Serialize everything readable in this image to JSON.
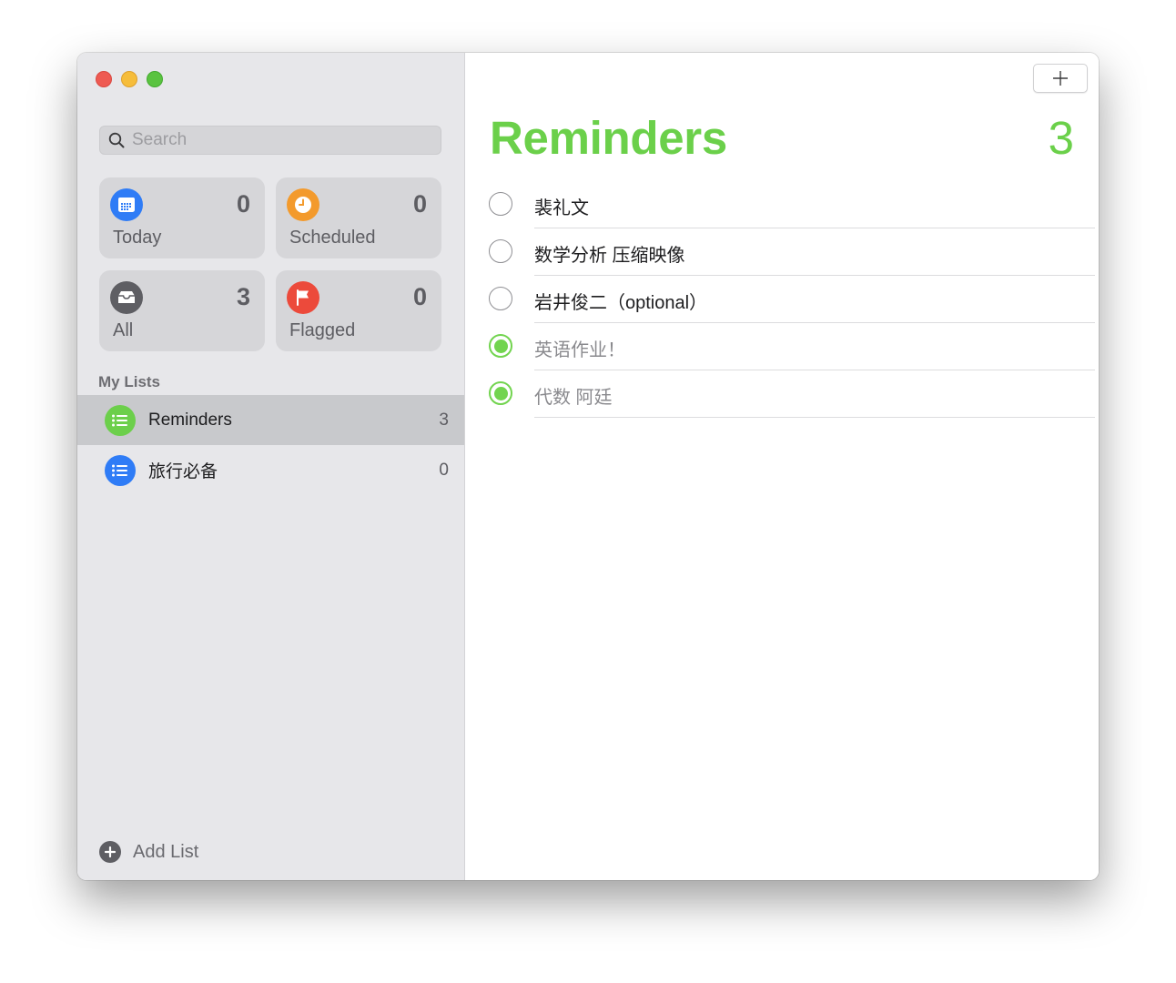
{
  "window": {
    "controls": [
      "close",
      "minimize",
      "zoom"
    ]
  },
  "sidebar": {
    "search": {
      "placeholder": "Search",
      "value": ""
    },
    "smart_lists": [
      {
        "id": "today",
        "label": "Today",
        "count": "0",
        "icon": "calendar-icon",
        "color": "#2f7cf6"
      },
      {
        "id": "scheduled",
        "label": "Scheduled",
        "count": "0",
        "icon": "clock-icon",
        "color": "#f39a2c"
      },
      {
        "id": "all",
        "label": "All",
        "count": "3",
        "icon": "tray-icon",
        "color": "#5e5e63"
      },
      {
        "id": "flagged",
        "label": "Flagged",
        "count": "0",
        "icon": "flag-icon",
        "color": "#ec4a3b"
      }
    ],
    "my_lists_header": "My Lists",
    "lists": [
      {
        "name": "Reminders",
        "count": "3",
        "color": "#6ccf4b",
        "selected": true
      },
      {
        "name": "旅行必备",
        "count": "0",
        "color": "#2f7cf6",
        "selected": false
      }
    ],
    "add_list_label": "Add List"
  },
  "main": {
    "title": "Reminders",
    "count": "3",
    "accent": "#6bd04a",
    "add_button_label": "+",
    "tasks": [
      {
        "text": "裴礼文",
        "completed": false
      },
      {
        "text": "数学分析 压缩映像",
        "completed": false
      },
      {
        "text": "岩井俊二（optional）",
        "completed": false
      },
      {
        "text": "英语作业！",
        "completed": true
      },
      {
        "text": "代数 阿廷",
        "completed": true
      }
    ]
  }
}
